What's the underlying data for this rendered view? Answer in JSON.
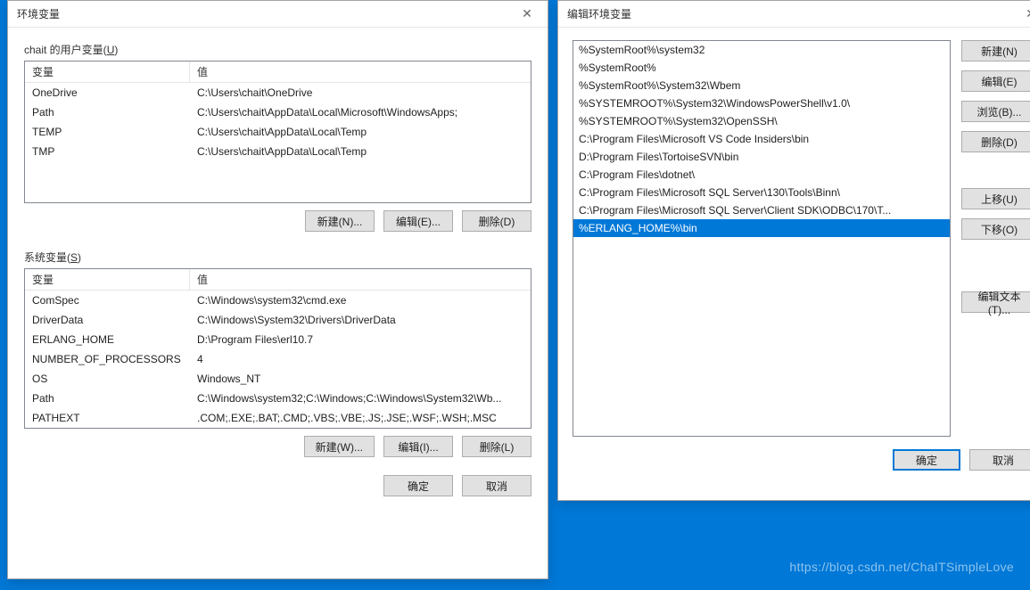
{
  "left": {
    "title": "环境变量",
    "userSectionLabel": "chait 的用户变量(",
    "userSectionKey": "U",
    "userSectionLabelEnd": ")",
    "sysSectionLabel": "系统变量(",
    "sysSectionKey": "S",
    "sysSectionLabelEnd": ")",
    "colVar": "变量",
    "colVal": "值",
    "userVars": [
      {
        "name": "OneDrive",
        "value": "C:\\Users\\chait\\OneDrive"
      },
      {
        "name": "Path",
        "value": "C:\\Users\\chait\\AppData\\Local\\Microsoft\\WindowsApps;"
      },
      {
        "name": "TEMP",
        "value": "C:\\Users\\chait\\AppData\\Local\\Temp"
      },
      {
        "name": "TMP",
        "value": "C:\\Users\\chait\\AppData\\Local\\Temp"
      }
    ],
    "sysVars": [
      {
        "name": "ComSpec",
        "value": "C:\\Windows\\system32\\cmd.exe"
      },
      {
        "name": "DriverData",
        "value": "C:\\Windows\\System32\\Drivers\\DriverData"
      },
      {
        "name": "ERLANG_HOME",
        "value": "D:\\Program Files\\erl10.7"
      },
      {
        "name": "NUMBER_OF_PROCESSORS",
        "value": "4"
      },
      {
        "name": "OS",
        "value": "Windows_NT"
      },
      {
        "name": "Path",
        "value": "C:\\Windows\\system32;C:\\Windows;C:\\Windows\\System32\\Wb..."
      },
      {
        "name": "PATHEXT",
        "value": ".COM;.EXE;.BAT;.CMD;.VBS;.VBE;.JS;.JSE;.WSF;.WSH;.MSC"
      }
    ],
    "btnNewUser": "新建(N)...",
    "btnEditUser": "编辑(E)...",
    "btnDeleteUser": "删除(D)",
    "btnNewSys": "新建(W)...",
    "btnEditSys": "编辑(I)...",
    "btnDeleteSys": "删除(L)",
    "btnOk": "确定",
    "btnCancel": "取消"
  },
  "right": {
    "title": "编辑环境变量",
    "paths": [
      "%SystemRoot%\\system32",
      "%SystemRoot%",
      "%SystemRoot%\\System32\\Wbem",
      "%SYSTEMROOT%\\System32\\WindowsPowerShell\\v1.0\\",
      "%SYSTEMROOT%\\System32\\OpenSSH\\",
      "C:\\Program Files\\Microsoft VS Code Insiders\\bin",
      "D:\\Program Files\\TortoiseSVN\\bin",
      "C:\\Program Files\\dotnet\\",
      "C:\\Program Files\\Microsoft SQL Server\\130\\Tools\\Binn\\",
      "C:\\Program Files\\Microsoft SQL Server\\Client SDK\\ODBC\\170\\T...",
      "%ERLANG_HOME%\\bin"
    ],
    "selectedIndex": 10,
    "btnNew": "新建(N)",
    "btnEdit": "编辑(E)",
    "btnBrowse": "浏览(B)...",
    "btnDelete": "删除(D)",
    "btnUp": "上移(U)",
    "btnDown": "下移(O)",
    "btnEditText": "编辑文本(T)...",
    "btnOk": "确定",
    "btnCancel": "取消"
  },
  "watermark": "https://blog.csdn.net/ChaITSimpleLove"
}
